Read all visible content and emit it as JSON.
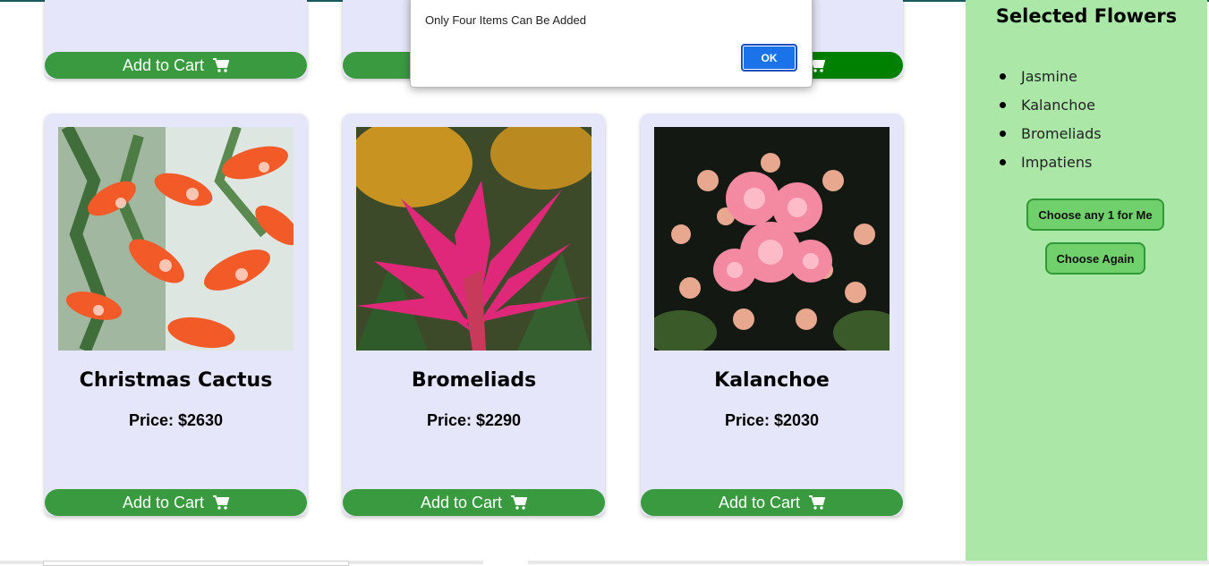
{
  "products": [
    {
      "id": "christmas-cactus",
      "name": "Christmas Cactus",
      "price": "Price: $2630",
      "add_label": "Add to Cart"
    },
    {
      "id": "bromeliads",
      "name": "Bromeliads",
      "price": "Price: $2290",
      "add_label": "Add to Cart"
    },
    {
      "id": "kalanchoe",
      "name": "Kalanchoe",
      "price": "Price: $2030",
      "add_label": "Add to Cart"
    }
  ],
  "top_row": {
    "add_label": "Add to Cart"
  },
  "sidebar": {
    "title": "Selected Flowers",
    "items": [
      "Jasmine",
      "Kalanchoe",
      "Bromeliads",
      "Impatiens"
    ],
    "random_button": "Choose any 1 for Me",
    "reset_button": "Choose Again"
  },
  "alert": {
    "message": "Only Four Items Can Be Added",
    "ok_label": "OK"
  },
  "colors": {
    "card_bg": "#e6e6fa",
    "add_button": "#3a9a40",
    "add_button_active": "#008000",
    "sidebar_bg": "#abe8a8",
    "side_button": "#6fd06c",
    "ok_button": "#1a73e8"
  },
  "icons": {
    "cart": "cart-icon"
  }
}
